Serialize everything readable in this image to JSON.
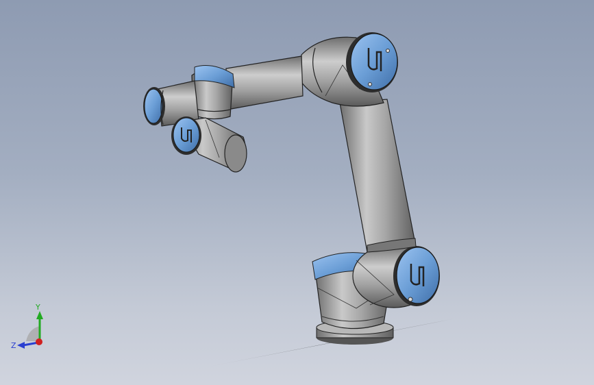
{
  "view": {
    "model_name": "UR robotic arm",
    "background_top": "#8e9bb2",
    "background_bottom": "#d0d4de",
    "body_color": "#9a9a9a",
    "cap_color": "#6b9ed6"
  },
  "triad": {
    "x_label": "",
    "y_label": "Y",
    "z_label": "Z",
    "y_color": "#22aa22",
    "z_color": "#2a3fd0",
    "x_color": "#d02020"
  },
  "logos": {
    "shoulder_logo": "UR",
    "elbow_logo": "UR",
    "wrist_logo": "UR"
  }
}
